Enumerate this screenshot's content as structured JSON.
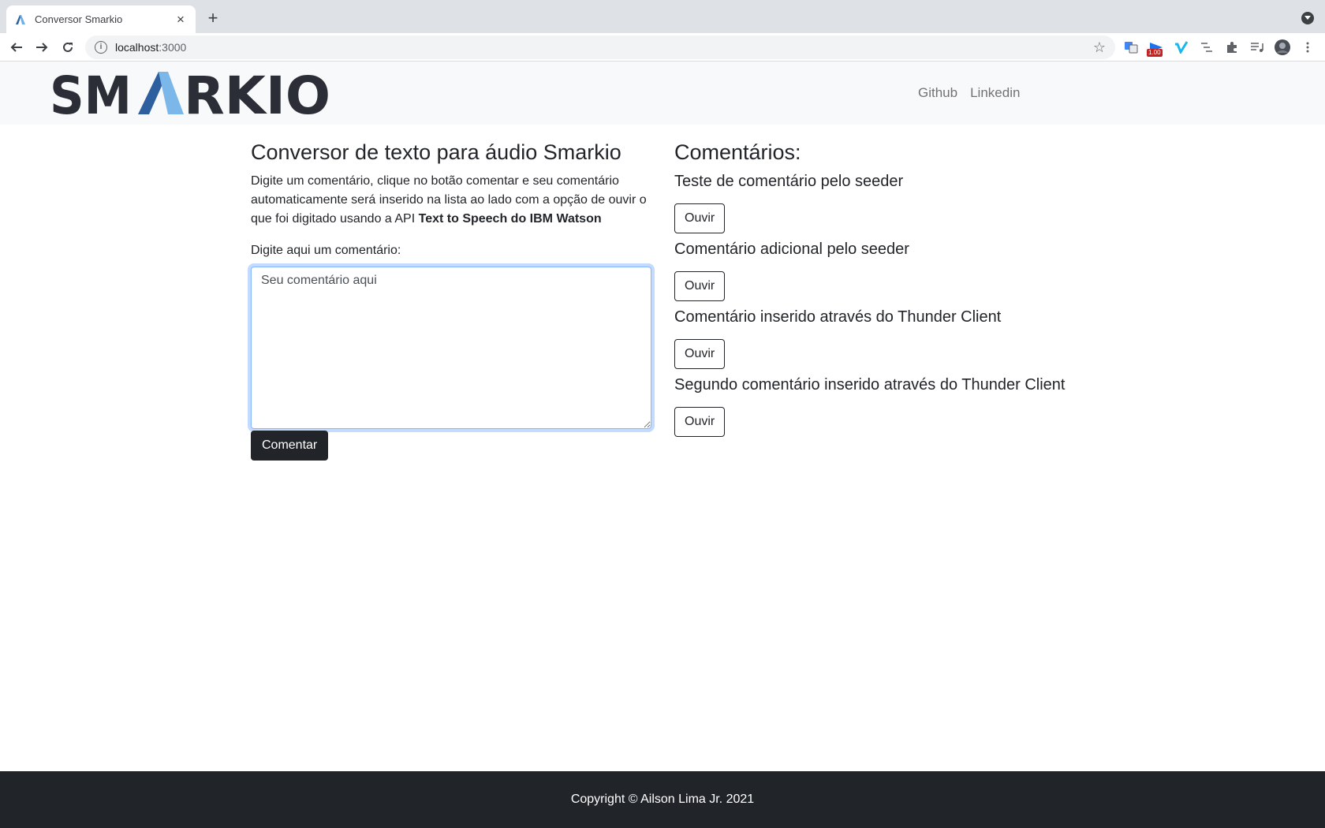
{
  "browser": {
    "tab_title": "Conversor Smarkio",
    "new_tab_symbol": "+",
    "close_symbol": "×",
    "url_host": "localhost",
    "url_port": ":3000",
    "extension_badge": "1.00"
  },
  "navbar": {
    "logo_text": "SMARKIO",
    "links": [
      {
        "label": "Github"
      },
      {
        "label": "Linkedin"
      }
    ]
  },
  "converter": {
    "title": "Conversor de texto para áudio Smarkio",
    "description": "Digite um comentário, clique no botão comentar e seu comentário automaticamente será inserido na lista ao lado com a opção de ouvir o que foi digitado usando a API ",
    "description_bold": "Text to Speech do IBM Watson",
    "field_label": "Digite aqui um comentário:",
    "placeholder": "Seu comentário aqui",
    "submit_label": "Comentar"
  },
  "comments": {
    "title": "Comentários:",
    "items": [
      {
        "text": "Teste de comentário pelo seeder",
        "button": "Ouvir"
      },
      {
        "text": "Comentário adicional pelo seeder",
        "button": "Ouvir"
      },
      {
        "text": "Comentário inserido através do Thunder Client",
        "button": "Ouvir"
      },
      {
        "text": "Segundo comentário inserido através do Thunder Client",
        "button": "Ouvir"
      }
    ]
  },
  "footer": {
    "text": "Copyright © Ailson Lima Jr. 2021"
  },
  "colors": {
    "logo_dark": "#2b2e37",
    "logo_blue": "#4a90d9",
    "logo_light_blue": "#7cb7ea",
    "footer_bg": "#212529"
  }
}
